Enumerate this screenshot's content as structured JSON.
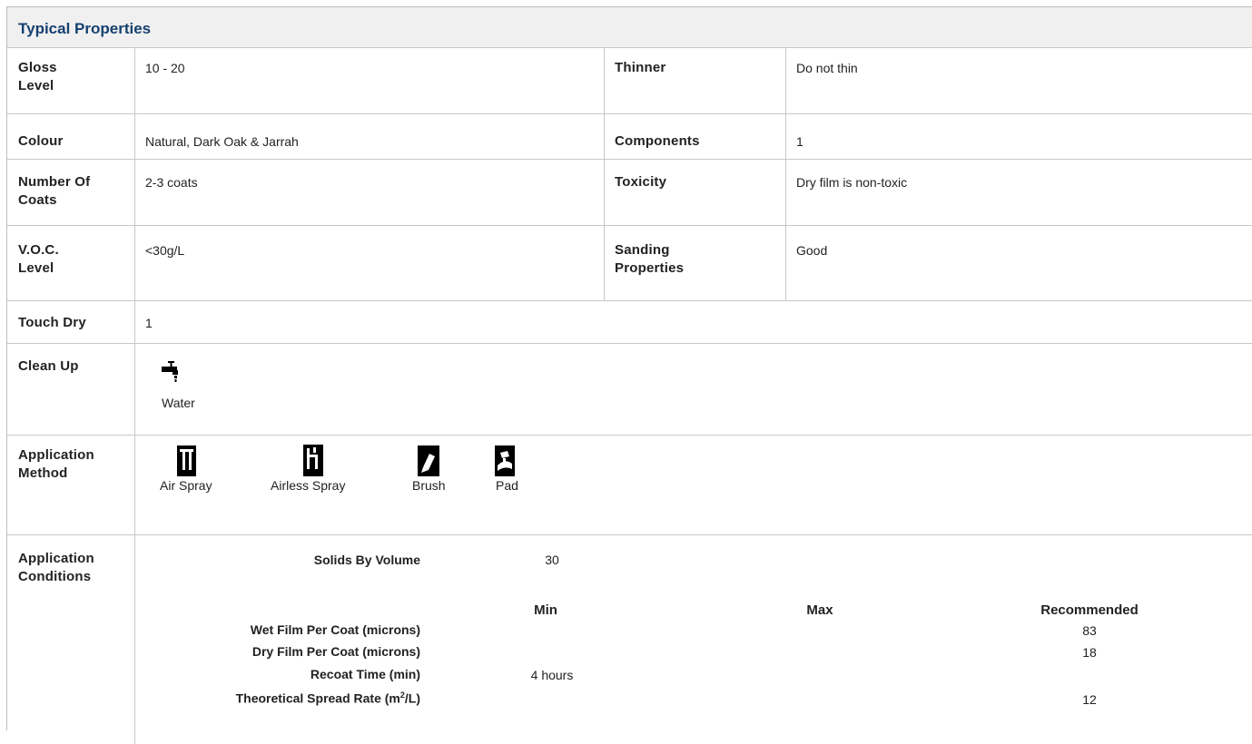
{
  "title": "Typical Properties",
  "rows": {
    "gloss": {
      "label": "Gloss Level",
      "label_l1": "Gloss",
      "label_l2": "Level",
      "value": "10 - 20"
    },
    "thinner": {
      "label": "Thinner",
      "value": "Do not thin"
    },
    "colour": {
      "label": "Colour",
      "value": "Natural, Dark Oak & Jarrah"
    },
    "components": {
      "label": "Components",
      "value": "1"
    },
    "coats": {
      "label": "Number Of Coats",
      "label_l1": "Number Of",
      "label_l2": "Coats",
      "value": "2-3 coats"
    },
    "toxicity": {
      "label": "Toxicity",
      "value": "Dry film is non-toxic"
    },
    "voc": {
      "label": "V.O.C. Level",
      "label_l1": "V.O.C.",
      "label_l2": "Level",
      "value": "<30g/L"
    },
    "sanding": {
      "label": "Sanding Properties",
      "label_l1": "Sanding",
      "label_l2": "Properties",
      "value": "Good"
    },
    "touch_dry": {
      "label": "Touch Dry",
      "value": "1"
    },
    "clean_up": {
      "label": "Clean Up",
      "items": [
        {
          "name": "Water",
          "icon": "water-tap-icon"
        }
      ]
    },
    "application_method": {
      "label_l1": "Application",
      "label_l2": "Method",
      "items": [
        {
          "name": "Air Spray",
          "icon": "air-spray-icon"
        },
        {
          "name": "Airless Spray",
          "icon": "airless-spray-icon"
        },
        {
          "name": "Brush",
          "icon": "brush-icon"
        },
        {
          "name": "Pad",
          "icon": "pad-icon"
        }
      ]
    },
    "application_conditions": {
      "label_l1": "Application",
      "label_l2": "Conditions",
      "solids_label": "Solids By Volume",
      "solids_value": "30",
      "headers": {
        "min": "Min",
        "max": "Max",
        "recommended": "Recommended"
      },
      "lines": [
        {
          "label": "Wet Film Per Coat (microns)",
          "min": "",
          "max": "",
          "recommended": "83"
        },
        {
          "label": "Dry Film Per Coat (microns)",
          "min": "",
          "max": "",
          "recommended": "18"
        },
        {
          "label": "Recoat Time (min)",
          "min": "4 hours",
          "max": "",
          "recommended": ""
        },
        {
          "label_prefix": "Theoretical Spread Rate (m",
          "label_sup": "2",
          "label_suffix": "/L)",
          "min": "",
          "max": "",
          "recommended": "12"
        }
      ]
    }
  }
}
